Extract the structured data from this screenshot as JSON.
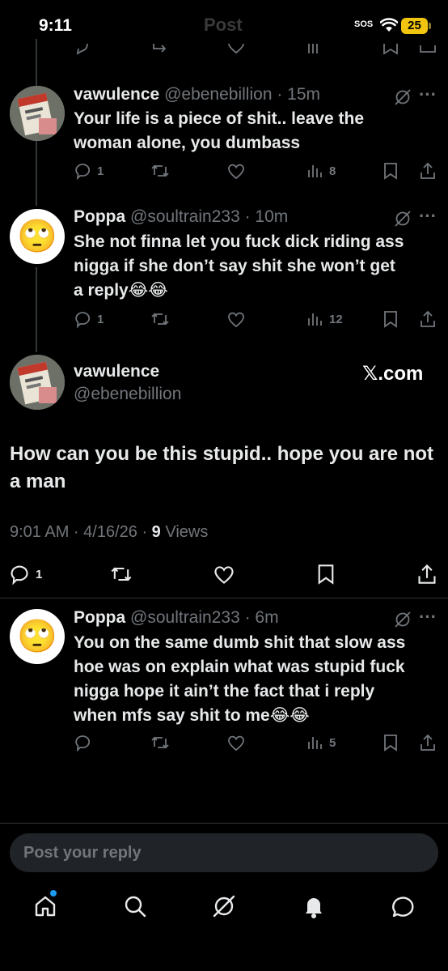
{
  "status_bar": {
    "time": "9:11",
    "title": "Post",
    "sos": "SOS",
    "battery": "25"
  },
  "replies_top": [
    {
      "name": "vawulence",
      "handle_time": "@ebenebillion · 15m",
      "text_lines": [
        "Your life is a piece of shit.. leave the",
        "woman alone, you dumbass"
      ],
      "replies": "1",
      "views": "8"
    },
    {
      "name": "Poppa",
      "handle_time": "@soultrain233 · 10m",
      "text_lines": [
        "She not finna let you fuck dick riding ass",
        "nigga if she don’t say shit she won’t get",
        "a reply😂😂"
      ],
      "replies": "1",
      "views": "12"
    }
  ],
  "main_post": {
    "name": "vawulence",
    "handle": "@ebenebillion",
    "source": "𝕏.com",
    "text": "How can you be this stupid.. hope you are not a man",
    "timestamp": "9:01 AM · 4/16/26 · ",
    "views_count": "9",
    "views_label": " Views",
    "replies": "1"
  },
  "reply_bottom": {
    "name": "Poppa",
    "handle_time": "@soultrain233 · 6m",
    "text_lines": [
      "You on the same dumb shit that slow ass",
      "hoe was on explain what was stupid fuck",
      "nigga hope it ain’t the fact that i reply",
      "when mfs say shit to me😂😂"
    ],
    "views": "5"
  },
  "composer": {
    "placeholder": "Post your reply"
  },
  "bottom_nav": [
    "home-icon",
    "search-icon",
    "grok-icon",
    "notifications-icon",
    "messages-icon"
  ],
  "colors": {
    "background": "#000000",
    "text": "#e7e9ea",
    "muted": "#71767b",
    "accent": "#1d9bf0",
    "battery": "#f1c40f"
  },
  "avatar_emoji": "🙄"
}
